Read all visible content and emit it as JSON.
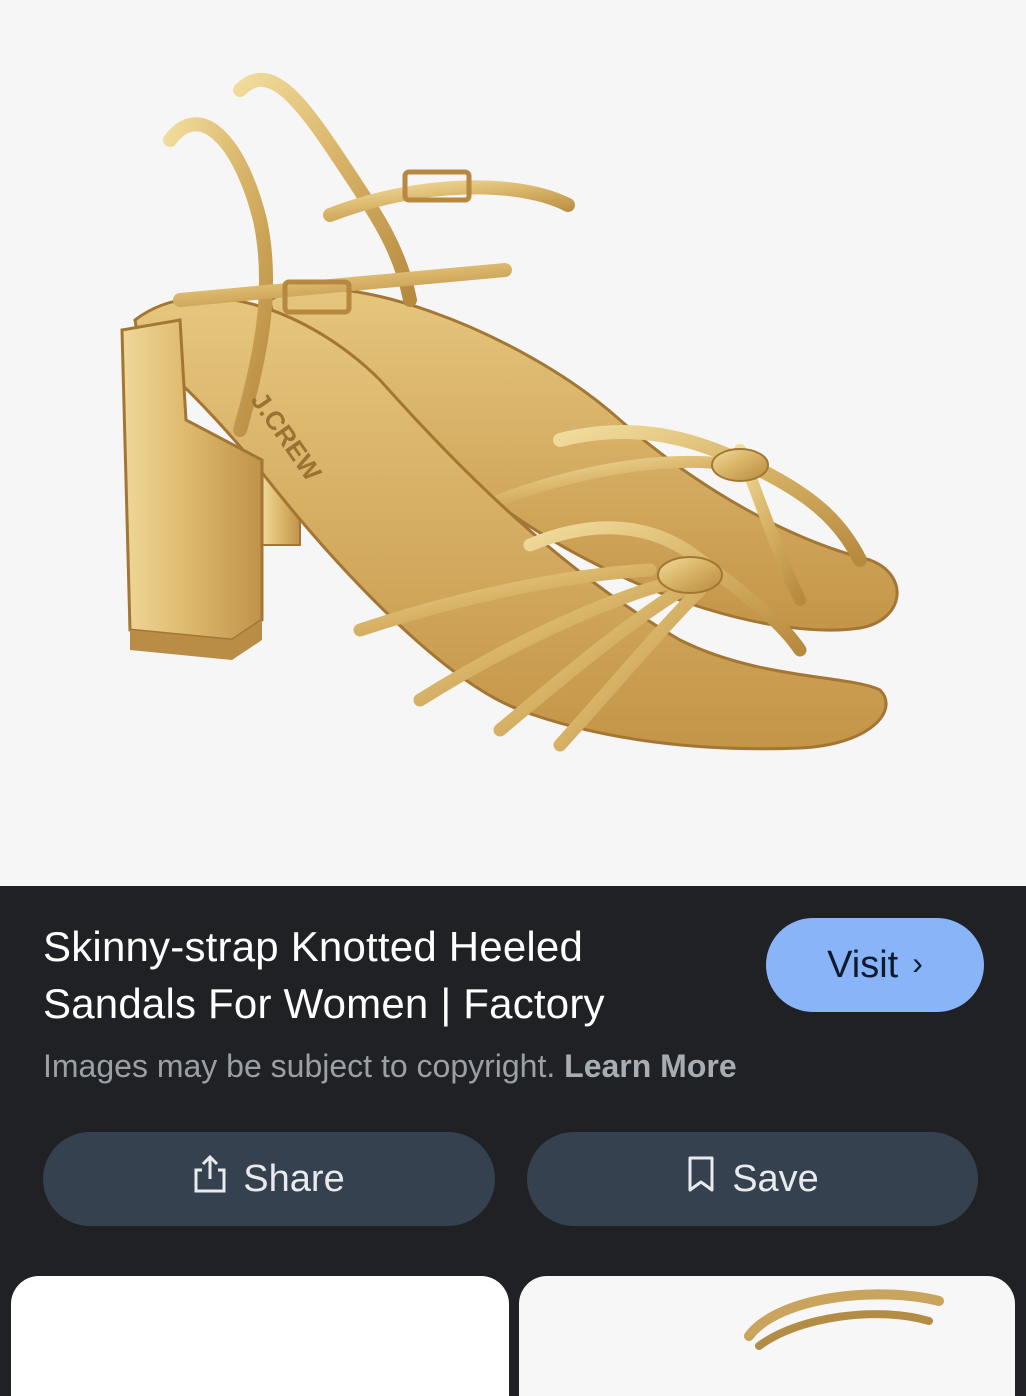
{
  "product": {
    "title_line1": "Skinny-strap Knotted Heeled",
    "title_line2": "Sandals For Women | Factory",
    "image_subject": "gold-metallic-strappy-heeled-sandals",
    "insole_brand_text": "J.CREW"
  },
  "actions": {
    "visit_label": "Visit",
    "share_label": "Share",
    "save_label": "Save"
  },
  "notice": {
    "copyright_text": "Images may be subject to copyright.",
    "learn_more_label": "Learn More"
  },
  "colors": {
    "panel_bg": "#202124",
    "visit_bg": "#8ab4f8",
    "action_bg": "#364150",
    "gold": "#d8b56a"
  },
  "related": [
    {
      "subject": "related-image-blank"
    },
    {
      "subject": "gold-strap-sandal"
    }
  ]
}
